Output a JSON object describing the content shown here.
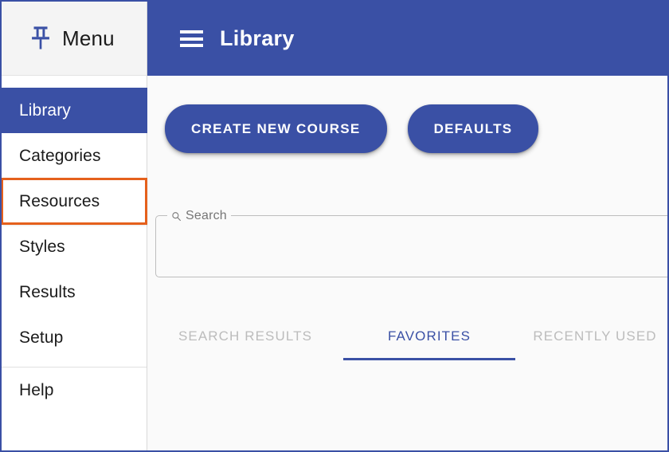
{
  "window": {
    "border_color": "#3a50a5",
    "background": "#fafafa"
  },
  "menu_panel": {
    "pin_icon": "pin-icon",
    "title": "Menu",
    "items": [
      {
        "label": "Library",
        "state": "active"
      },
      {
        "label": "Categories",
        "state": "normal"
      },
      {
        "label": "Resources",
        "state": "highlighted"
      },
      {
        "label": "Styles",
        "state": "normal"
      },
      {
        "label": "Results",
        "state": "normal"
      },
      {
        "label": "Setup",
        "state": "normal"
      },
      {
        "label": "Help",
        "state": "normal"
      }
    ],
    "highlight_color": "#e5601c",
    "active_color": "#3a50a5"
  },
  "app_bar": {
    "menu_icon": "hamburger-icon",
    "title": "Library",
    "background": "#3a50a5"
  },
  "toolbar": {
    "create_course_label": "CREATE NEW COURSE",
    "defaults_label": "DEFAULTS"
  },
  "search": {
    "icon": "search-icon",
    "label": "Search",
    "value": "",
    "placeholder": ""
  },
  "tabs": [
    {
      "label": "SEARCH RESULTS",
      "state": "inactive"
    },
    {
      "label": "FAVORITES",
      "state": "active"
    },
    {
      "label": "RECENTLY USED",
      "state": "inactive"
    }
  ]
}
